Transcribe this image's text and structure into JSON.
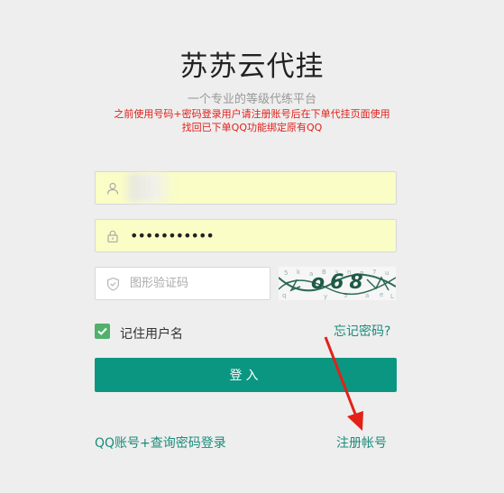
{
  "header": {
    "title": "苏苏云代挂",
    "subtitle": "一个专业的等级代练平台",
    "notice_line1": "之前使用号码+密码登录用户请注册账号后在下单代挂页面使用",
    "notice_line2": "找回已下单QQ功能绑定原有QQ"
  },
  "form": {
    "username_value": "",
    "password_value": "•••••••••••",
    "captcha_placeholder": "图形验证码",
    "captcha_text": "o68"
  },
  "options": {
    "remember_label": "记住用户名",
    "remember_checked": true,
    "forgot_label": "忘记密码?"
  },
  "actions": {
    "login_label": "登入",
    "qq_login_label": "QQ账号+查询密码登录",
    "register_label": "注册帐号"
  },
  "colors": {
    "primary": "#0b9682",
    "link": "#1a8c7b",
    "notice": "#e0201a",
    "autofill": "#fafdc6",
    "checkbox": "#52b06d",
    "arrow": "#e32119"
  }
}
